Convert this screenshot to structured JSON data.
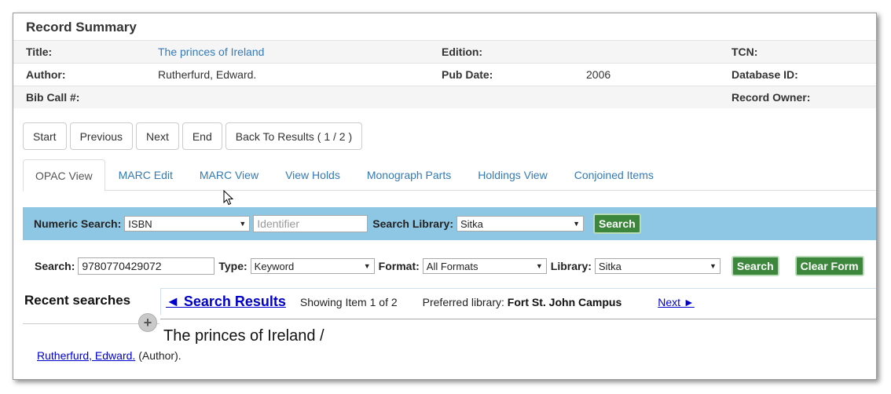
{
  "record_summary": {
    "heading": "Record Summary",
    "rows": [
      {
        "l1": "Title:",
        "v1": "The princes of Ireland",
        "l2": "Edition:",
        "v2": "",
        "l3": "TCN:",
        "v3": ""
      },
      {
        "l1": "Author:",
        "v1": "Rutherfurd, Edward.",
        "l2": "Pub Date:",
        "v2": "2006",
        "l3": "Database ID:",
        "v3": ""
      },
      {
        "l1": "Bib Call #:",
        "v1": "",
        "l2": "",
        "v2": "",
        "l3": "Record Owner:",
        "v3": ""
      }
    ]
  },
  "nav_buttons": {
    "start": "Start",
    "previous": "Previous",
    "next": "Next",
    "end": "End",
    "back_to_results": "Back To Results ( 1 / 2 )"
  },
  "tabs": {
    "opac_view": "OPAC View",
    "marc_edit": "MARC Edit",
    "marc_view": "MARC View",
    "view_holds": "View Holds",
    "monograph_parts": "Monograph Parts",
    "holdings_view": "Holdings View",
    "conjoined_items": "Conjoined Items"
  },
  "numeric_search": {
    "label": "Numeric Search:",
    "type_value": "ISBN",
    "identifier_placeholder": "Identifier",
    "library_label": "Search Library:",
    "library_value": "Sitka",
    "search_button": "Search"
  },
  "main_search": {
    "search_label": "Search:",
    "search_value": "9780770429072",
    "type_label": "Type:",
    "type_value": "Keyword",
    "format_label": "Format:",
    "format_value": "All Formats",
    "library_label": "Library:",
    "library_value": "Sitka",
    "search_button": "Search",
    "clear_button": "Clear Form"
  },
  "recent_searches": {
    "title": "Recent searches",
    "plus": "+"
  },
  "results_nav": {
    "back": "◄ Search Results",
    "showing": "Showing Item 1 of 2",
    "preferred_label": "Preferred library:",
    "preferred_value": "Fort St. John Campus",
    "next": "Next ►"
  },
  "record": {
    "title": "The princes of Ireland /",
    "author_link": "Rutherfurd, Edward.",
    "author_role": "(Author)."
  },
  "colors": {
    "link": "#337ab7",
    "numeric_bar": "#8ec7e3",
    "green_button": "#3c873c",
    "result_link": "#0000cc"
  }
}
